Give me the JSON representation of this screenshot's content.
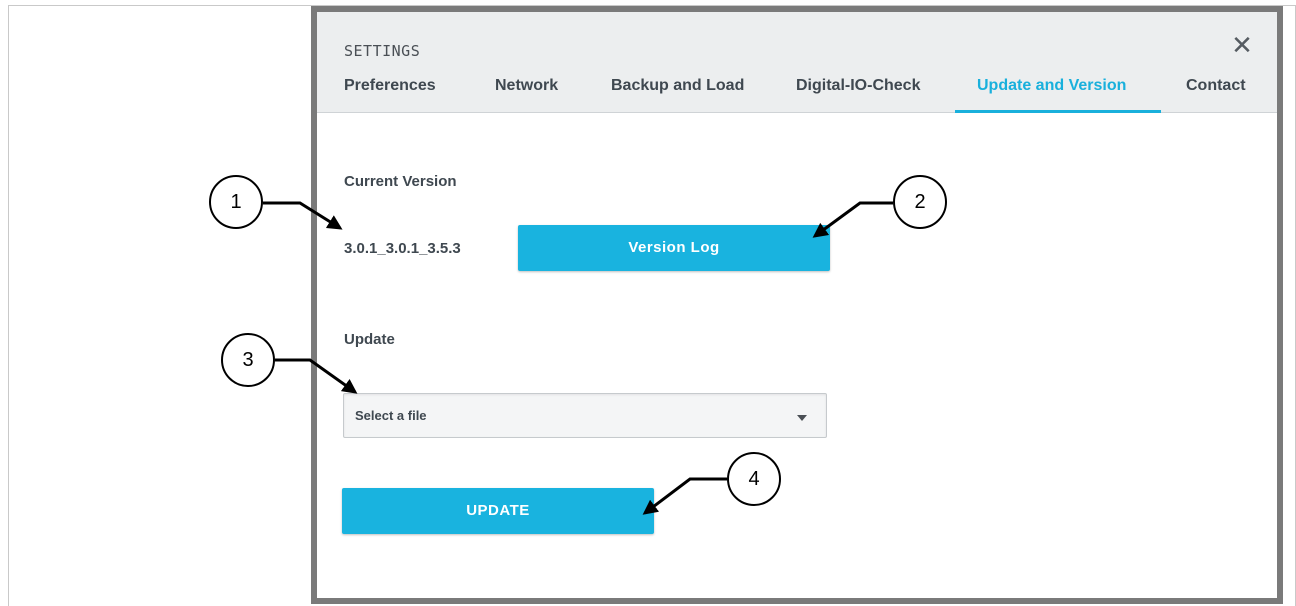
{
  "dialog": {
    "title": "SETTINGS",
    "close_icon": "close-icon",
    "tabs": [
      {
        "label": "Preferences",
        "active": false
      },
      {
        "label": "Network",
        "active": false
      },
      {
        "label": "Backup and Load",
        "active": false
      },
      {
        "label": "Digital-IO-Check",
        "active": false
      },
      {
        "label": "Update and Version",
        "active": true
      },
      {
        "label": "Contact",
        "active": false
      }
    ],
    "accent_color": "#19b0dc"
  },
  "version": {
    "label": "Current Version",
    "value": "3.0.1_3.0.1_3.5.3",
    "log_button": "Version Log"
  },
  "update": {
    "label": "Update",
    "file_select_value": "Select a file",
    "button": "UPDATE"
  },
  "callouts": [
    "1",
    "2",
    "3",
    "4"
  ]
}
